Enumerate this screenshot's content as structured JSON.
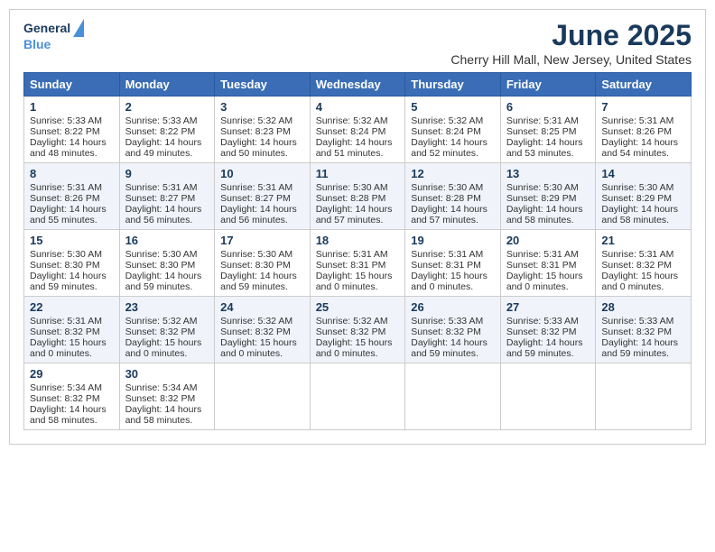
{
  "header": {
    "logo_line1": "General",
    "logo_line2": "Blue",
    "month_title": "June 2025",
    "location": "Cherry Hill Mall, New Jersey, United States"
  },
  "days_of_week": [
    "Sunday",
    "Monday",
    "Tuesday",
    "Wednesday",
    "Thursday",
    "Friday",
    "Saturday"
  ],
  "weeks": [
    [
      {
        "day": "1",
        "sunrise": "5:33 AM",
        "sunset": "8:22 PM",
        "daylight": "14 hours and 48 minutes."
      },
      {
        "day": "2",
        "sunrise": "5:33 AM",
        "sunset": "8:22 PM",
        "daylight": "14 hours and 49 minutes."
      },
      {
        "day": "3",
        "sunrise": "5:32 AM",
        "sunset": "8:23 PM",
        "daylight": "14 hours and 50 minutes."
      },
      {
        "day": "4",
        "sunrise": "5:32 AM",
        "sunset": "8:24 PM",
        "daylight": "14 hours and 51 minutes."
      },
      {
        "day": "5",
        "sunrise": "5:32 AM",
        "sunset": "8:24 PM",
        "daylight": "14 hours and 52 minutes."
      },
      {
        "day": "6",
        "sunrise": "5:31 AM",
        "sunset": "8:25 PM",
        "daylight": "14 hours and 53 minutes."
      },
      {
        "day": "7",
        "sunrise": "5:31 AM",
        "sunset": "8:26 PM",
        "daylight": "14 hours and 54 minutes."
      }
    ],
    [
      {
        "day": "8",
        "sunrise": "5:31 AM",
        "sunset": "8:26 PM",
        "daylight": "14 hours and 55 minutes."
      },
      {
        "day": "9",
        "sunrise": "5:31 AM",
        "sunset": "8:27 PM",
        "daylight": "14 hours and 56 minutes."
      },
      {
        "day": "10",
        "sunrise": "5:31 AM",
        "sunset": "8:27 PM",
        "daylight": "14 hours and 56 minutes."
      },
      {
        "day": "11",
        "sunrise": "5:30 AM",
        "sunset": "8:28 PM",
        "daylight": "14 hours and 57 minutes."
      },
      {
        "day": "12",
        "sunrise": "5:30 AM",
        "sunset": "8:28 PM",
        "daylight": "14 hours and 57 minutes."
      },
      {
        "day": "13",
        "sunrise": "5:30 AM",
        "sunset": "8:29 PM",
        "daylight": "14 hours and 58 minutes."
      },
      {
        "day": "14",
        "sunrise": "5:30 AM",
        "sunset": "8:29 PM",
        "daylight": "14 hours and 58 minutes."
      }
    ],
    [
      {
        "day": "15",
        "sunrise": "5:30 AM",
        "sunset": "8:30 PM",
        "daylight": "14 hours and 59 minutes."
      },
      {
        "day": "16",
        "sunrise": "5:30 AM",
        "sunset": "8:30 PM",
        "daylight": "14 hours and 59 minutes."
      },
      {
        "day": "17",
        "sunrise": "5:30 AM",
        "sunset": "8:30 PM",
        "daylight": "14 hours and 59 minutes."
      },
      {
        "day": "18",
        "sunrise": "5:31 AM",
        "sunset": "8:31 PM",
        "daylight": "15 hours and 0 minutes."
      },
      {
        "day": "19",
        "sunrise": "5:31 AM",
        "sunset": "8:31 PM",
        "daylight": "15 hours and 0 minutes."
      },
      {
        "day": "20",
        "sunrise": "5:31 AM",
        "sunset": "8:31 PM",
        "daylight": "15 hours and 0 minutes."
      },
      {
        "day": "21",
        "sunrise": "5:31 AM",
        "sunset": "8:32 PM",
        "daylight": "15 hours and 0 minutes."
      }
    ],
    [
      {
        "day": "22",
        "sunrise": "5:31 AM",
        "sunset": "8:32 PM",
        "daylight": "15 hours and 0 minutes."
      },
      {
        "day": "23",
        "sunrise": "5:32 AM",
        "sunset": "8:32 PM",
        "daylight": "15 hours and 0 minutes."
      },
      {
        "day": "24",
        "sunrise": "5:32 AM",
        "sunset": "8:32 PM",
        "daylight": "15 hours and 0 minutes."
      },
      {
        "day": "25",
        "sunrise": "5:32 AM",
        "sunset": "8:32 PM",
        "daylight": "15 hours and 0 minutes."
      },
      {
        "day": "26",
        "sunrise": "5:33 AM",
        "sunset": "8:32 PM",
        "daylight": "14 hours and 59 minutes."
      },
      {
        "day": "27",
        "sunrise": "5:33 AM",
        "sunset": "8:32 PM",
        "daylight": "14 hours and 59 minutes."
      },
      {
        "day": "28",
        "sunrise": "5:33 AM",
        "sunset": "8:32 PM",
        "daylight": "14 hours and 59 minutes."
      }
    ],
    [
      {
        "day": "29",
        "sunrise": "5:34 AM",
        "sunset": "8:32 PM",
        "daylight": "14 hours and 58 minutes."
      },
      {
        "day": "30",
        "sunrise": "5:34 AM",
        "sunset": "8:32 PM",
        "daylight": "14 hours and 58 minutes."
      },
      null,
      null,
      null,
      null,
      null
    ]
  ]
}
